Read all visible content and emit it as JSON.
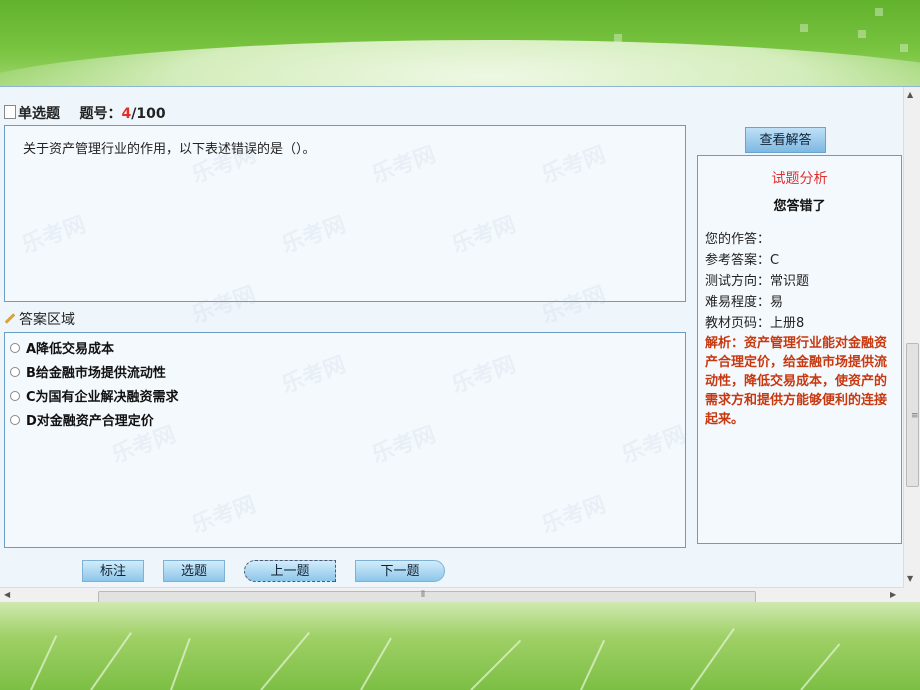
{
  "header": {
    "type_label": "单选题",
    "qno_prefix": "题号：",
    "qno_current": "4",
    "qno_total": "/100"
  },
  "question": {
    "text": "关于资产管理行业的作用，以下表述错误的是（）。"
  },
  "answer_area": {
    "title": "答案区域"
  },
  "options": [
    {
      "label": "A降低交易成本"
    },
    {
      "label": "B给金融市场提供流动性"
    },
    {
      "label": "C为国有企业解决融资需求"
    },
    {
      "label": "D对金融资产合理定价"
    }
  ],
  "view_answer_button": "查看解答",
  "analysis": {
    "title": "试题分析",
    "result": "您答错了",
    "your_answer": "您的作答：",
    "reference_answer": "参考答案：C",
    "test_direction": "测试方向：常识题",
    "difficulty": "难易程度：易",
    "textbook_page": "教材页码：上册8",
    "explanation": "解析：资产管理行业能对金融资产合理定价，给金融市场提供流动性，降低交易成本，使资产的需求方和提供方能够便利的连接起来。"
  },
  "nav_buttons": {
    "mark": "标注",
    "select": "选题",
    "prev": "上一题",
    "next": "下一题"
  },
  "watermark": "乐考网",
  "colors": {
    "accent_red": "#e0302a",
    "analysis_text": "#c8380f",
    "panel_border": "#6a9cc4"
  },
  "icons": [
    "document-icon",
    "pencil-icon",
    "radio-icon",
    "arrow-up-icon",
    "arrow-down-icon",
    "arrow-left-icon",
    "arrow-right-icon"
  ]
}
